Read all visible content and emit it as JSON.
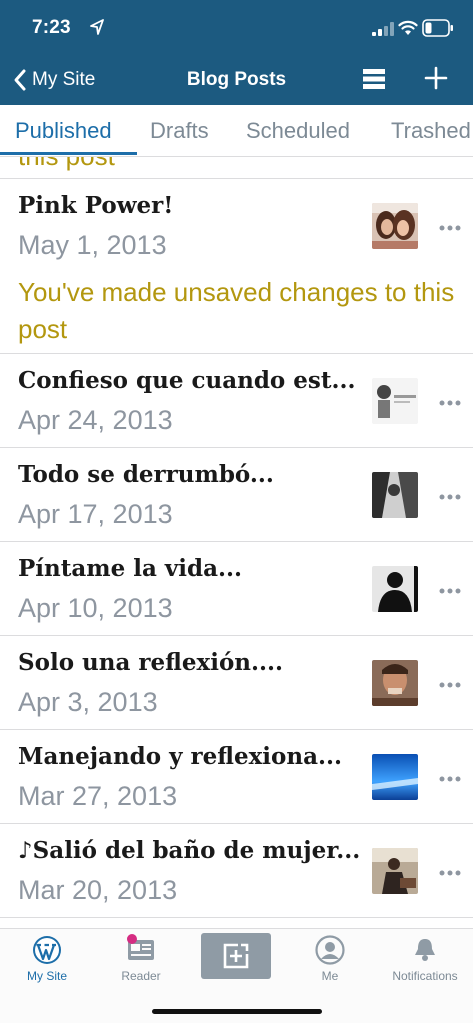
{
  "status_bar": {
    "time": "7:23"
  },
  "nav": {
    "back_label": "My Site",
    "title": "Blog Posts"
  },
  "tabs": [
    {
      "label": "Published",
      "active": true
    },
    {
      "label": "Drafts",
      "active": false
    },
    {
      "label": "Scheduled",
      "active": false
    },
    {
      "label": "Trashed",
      "active": false
    }
  ],
  "partial_row": {
    "text": "this post"
  },
  "posts": [
    {
      "title": "Pink Power!",
      "date": "May 1, 2013",
      "note": "You've made unsaved changes to this post"
    },
    {
      "title": "Confieso que cuando est...",
      "date": "Apr 24, 2013"
    },
    {
      "title": "Todo se derrumbó...",
      "date": "Apr 17, 2013"
    },
    {
      "title": "Píntame la vida...",
      "date": "Apr 10, 2013"
    },
    {
      "title": "Solo una reflexión....",
      "date": "Apr 3, 2013"
    },
    {
      "title": "Manejando y reflexiona...",
      "date": "Mar 27, 2013"
    },
    {
      "title": "♪Salió del baño de mujer...",
      "date": "Mar 20, 2013"
    }
  ],
  "tab_bar": {
    "items": [
      {
        "label": "My Site",
        "icon": "wordpress-icon",
        "active": true
      },
      {
        "label": "Reader",
        "icon": "reader-icon",
        "active": false
      },
      {
        "label": "",
        "icon": "new-post-icon",
        "active": false
      },
      {
        "label": "Me",
        "icon": "profile-icon",
        "active": false
      },
      {
        "label": "Notifications",
        "icon": "bell-icon",
        "active": false
      }
    ]
  },
  "colors": {
    "header_bg": "#1c5a80",
    "accent": "#1d6ea9",
    "warning_text": "#b3970f",
    "muted_text": "#8e96a0",
    "notification_dot": "#d52c82"
  }
}
